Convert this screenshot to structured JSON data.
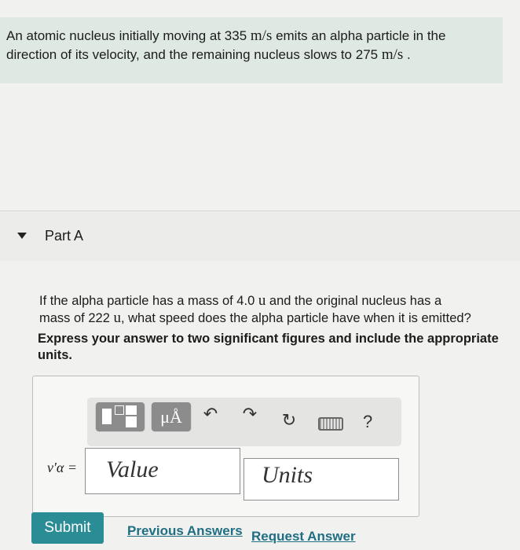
{
  "problem": {
    "line1_before": "An atomic nucleus initially moving at 335 ",
    "unit1": "m/s",
    "line1_after": " emits an alpha particle in the",
    "line2_before": "direction of its velocity, and the remaining nucleus slows to 275 ",
    "unit2": "m/s",
    "line2_after": " ."
  },
  "part": {
    "title": "Part A"
  },
  "question": {
    "line1_before": "If the alpha particle has a mass of 4.0 ",
    "u1": "u",
    "line1_after": " and the original nucleus has a",
    "line2_before": "mass of 222 ",
    "u2": "u",
    "line2_after": ", what speed does the alpha particle have when it is emitted?"
  },
  "instruction": "Express your answer to two significant figures and include the appropriate units.",
  "toolbar": {
    "symbols_label": "μÅ",
    "undo_glyph": "↶",
    "redo_glyph": "↷",
    "reset_glyph": "↻",
    "help_glyph": "?"
  },
  "answer": {
    "variable_label": "v′α =",
    "value_placeholder": "Value",
    "units_placeholder": "Units"
  },
  "actions": {
    "submit_label": "Submit",
    "previous_answers_label": "Previous Answers",
    "request_answer_label": "Request Answer"
  },
  "colors": {
    "problem_bg": "#dfe9e4",
    "submit_bg": "#2a8c95",
    "link": "#1f6f84"
  }
}
